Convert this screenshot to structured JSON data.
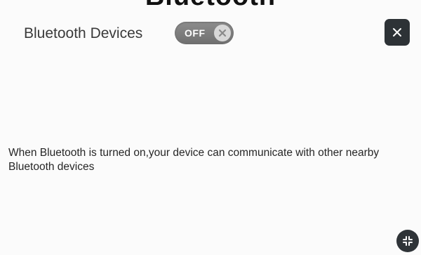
{
  "page": {
    "cut_title": "Bluetooth"
  },
  "header": {
    "title": "Bluetooth Devices"
  },
  "toggle": {
    "label": "OFF",
    "state": "off",
    "icon": "x-circle-icon"
  },
  "close_button": {
    "icon": "close-icon"
  },
  "body": {
    "description": "When Bluetooth is turned on,your device can communicate with other nearby Bluetooth devices"
  },
  "corner_button": {
    "icon": "collapse-icon"
  },
  "colors": {
    "background": "#fbfbfb",
    "toggle_off": "#7a7a7a",
    "button_dark": "#2d3236"
  }
}
